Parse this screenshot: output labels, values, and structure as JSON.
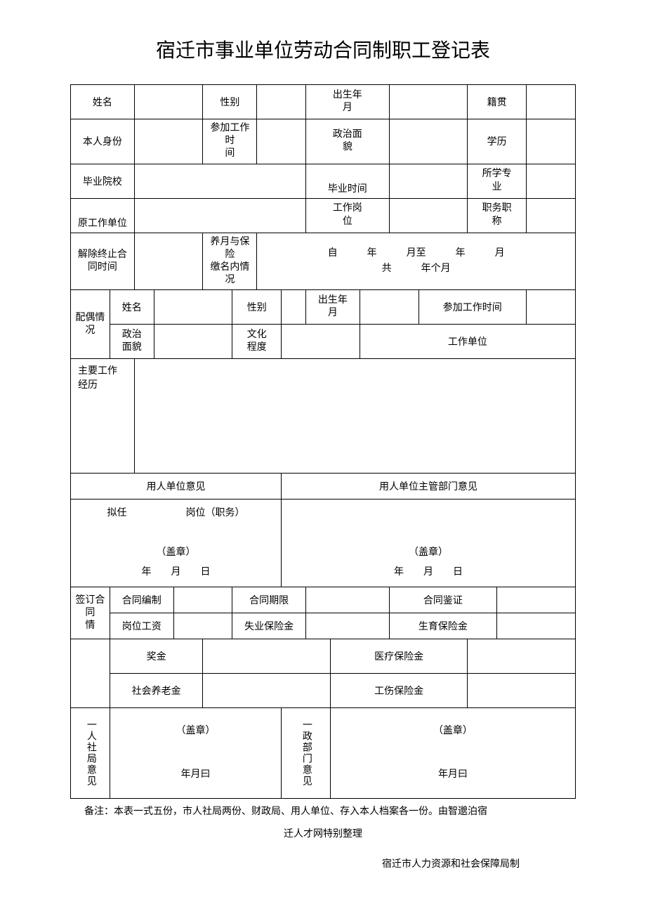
{
  "title": "宿迁市事业单位劳动合同制职工登记表",
  "labels": {
    "name": "姓名",
    "sex": "性别",
    "birth": "出生年\n月",
    "native": "籍贯",
    "id": "本人身份",
    "workstart": "参加工作时\n间",
    "political": "政治面\n貌",
    "edu": "学历",
    "school": "毕业院校",
    "gradtime": "毕业时间",
    "major": "所学专\n业",
    "prev_unit": "原工作单位",
    "post": "工作岗\n位",
    "title_pos": "职务职\n称",
    "term_time": "解除终止合\n同时间",
    "ins_label": "养月与保险\n缴名内情况",
    "ins_span": "自　　　年　　　月至　　　年　　　月\n共　　　年个月",
    "spouse": "配偶情\n况",
    "spouse_name": "姓名",
    "spouse_sex": "性别",
    "spouse_birth": "出生年\n月",
    "spouse_workstart": "参加工作时间",
    "spouse_political": "政治\n面貌",
    "spouse_edu": "文化\n程度",
    "spouse_unit": "工作单位",
    "work_hist": "主要工作经历",
    "unit_opinion": "用人单位意见",
    "dept_opinion": "用人单位主管部门意见",
    "unit_opinion_body": "拟任　　　　　　岗位（职务）\n\n（盖章）\n年　　月　　日",
    "dept_opinion_body": "\n\n（盖章）\n年　　月　　日",
    "contract": "签订合同\n情",
    "c_no": "合同编制",
    "c_term": "合同期限",
    "c_auth": "合同鉴证",
    "c_wage": "岗位工资",
    "c_unemp": "失业保险金",
    "c_birth": "生育保险金",
    "c_bonus": "奖金",
    "c_med": "医疗保险金",
    "c_pension": "社会养老金",
    "c_injury": "工伤保险金",
    "hr_opinion": "一人社局意见",
    "fin_opinion": "一政部门意见",
    "stamp_date": "（盖章）\n\n年月曰"
  },
  "footer": {
    "note1": "备注：本表一式五份，市人社局两份、财政局、用人单位、存入本人档案各一份。由智邈泊宿",
    "note2": "迁人才网特别整理",
    "note3": "宿迁市人力资源和社会保障局制"
  }
}
